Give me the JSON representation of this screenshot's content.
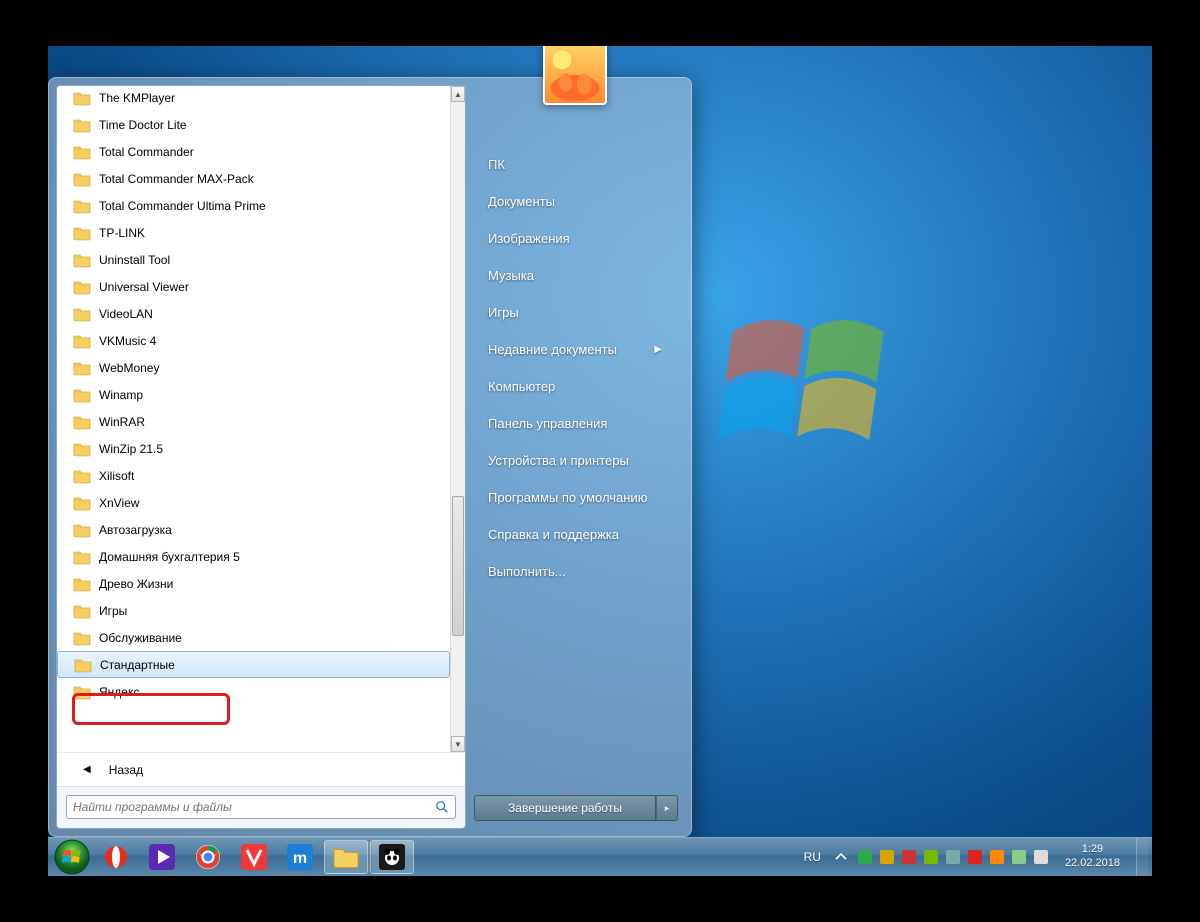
{
  "programs": [
    "The KMPlayer",
    "Time Doctor Lite",
    "Total Commander",
    "Total Commander MAX-Pack",
    "Total Commander Ultima Prime",
    "TP-LINK",
    "Uninstall Tool",
    "Universal Viewer",
    "VideoLAN",
    "VKMusic 4",
    "WebMoney",
    "Winamp",
    "WinRAR",
    "WinZip 21.5",
    "Xilisoft",
    "XnView",
    "Автозагрузка",
    "Домашняя бухгалтерия 5",
    "Древо Жизни",
    "Игры",
    "Обслуживание",
    "Стандартные",
    "Яндекс"
  ],
  "selected_program_index": 21,
  "back_label": "Назад",
  "search_placeholder": "Найти программы и файлы",
  "right_items": [
    {
      "label": "ПК",
      "arrow": false
    },
    {
      "label": "Документы",
      "arrow": false
    },
    {
      "label": "Изображения",
      "arrow": false
    },
    {
      "label": "Музыка",
      "arrow": false
    },
    {
      "label": "Игры",
      "arrow": false
    },
    {
      "label": "Недавние документы",
      "arrow": true
    },
    {
      "label": "Компьютер",
      "arrow": false
    },
    {
      "label": "Панель управления",
      "arrow": false
    },
    {
      "label": "Устройства и принтеры",
      "arrow": false
    },
    {
      "label": "Программы по умолчанию",
      "arrow": false
    },
    {
      "label": "Справка и поддержка",
      "arrow": false
    },
    {
      "label": "Выполнить...",
      "arrow": false
    }
  ],
  "shutdown_label": "Завершение работы",
  "taskbar": {
    "lang": "RU",
    "time": "1:29",
    "date": "22.02.2018",
    "pins": [
      {
        "name": "opera",
        "color": "#e4301a",
        "shape": "circle"
      },
      {
        "name": "media-player",
        "color": "#5b2ab5",
        "shape": "play"
      },
      {
        "name": "chrome",
        "color": "",
        "shape": "chrome"
      },
      {
        "name": "vivaldi",
        "color": "#ef3939",
        "shape": "v"
      },
      {
        "name": "maxthon",
        "color": "#1b7fd6",
        "shape": "m"
      },
      {
        "name": "explorer",
        "color": "#f4c95a",
        "shape": "folder",
        "active": true,
        "grouped": true
      },
      {
        "name": "app-panda",
        "color": "#1a1a1a",
        "shape": "panda",
        "active": true
      }
    ],
    "tray_icons": [
      "shield",
      "app1",
      "app2",
      "nvidia",
      "net1",
      "sec",
      "notify",
      "net2",
      "vol"
    ]
  }
}
